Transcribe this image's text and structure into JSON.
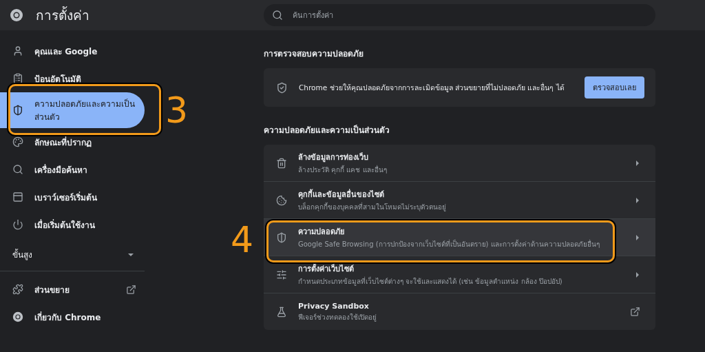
{
  "header": {
    "title": "การตั้งค่า"
  },
  "search": {
    "placeholder": "ค้นการตั้งค่า"
  },
  "sidebar": {
    "items": [
      {
        "label": "คุณและ Google",
        "selected": false
      },
      {
        "label": "ป้อนอัตโนมัติ",
        "selected": false
      },
      {
        "label": "ความปลอดภัยและความเป็นส่วนตัว",
        "selected": true
      },
      {
        "label": "ลักษณะที่ปรากฏ",
        "selected": false
      },
      {
        "label": "เครื่องมือค้นหา",
        "selected": false
      },
      {
        "label": "เบราว์เซอร์เริ่มต้น",
        "selected": false
      },
      {
        "label": "เมื่อเริ่มต้นใช้งาน",
        "selected": false
      }
    ],
    "advanced": {
      "label": "ขั้นสูง",
      "expanded": false
    },
    "bottom_items": [
      {
        "label": "ส่วนขยาย"
      },
      {
        "label": "เกี่ยวกับ Chrome"
      }
    ]
  },
  "safety_check": {
    "heading": "การตรวจสอบความปลอดภัย",
    "text": "Chrome ช่วยให้คุณปลอดภัยจากการละเมิดข้อมูล ส่วนขยายที่ไม่ปลอดภัย และอื่นๆ ได้",
    "button": "ตรวจสอบเลย"
  },
  "privacy": {
    "heading": "ความปลอดภัยและความเป็นส่วนตัว",
    "rows": [
      {
        "title": "ล้างข้อมูลการท่องเว็บ",
        "subtitle": "ล้างประวัติ คุกกี้ แคช และอื่นๆ",
        "kind": "arrow",
        "selected": false
      },
      {
        "title": "คุกกี้และข้อมูลอื่นของไซต์",
        "subtitle": "บล็อกคุกกี้ของบุคคลที่สามในโหมดไม่ระบุตัวตนอยู่",
        "kind": "arrow",
        "selected": false
      },
      {
        "title": "ความปลอดภัย",
        "subtitle": "Google Safe Browsing (การปกป้องจากเว็บไซต์ที่เป็นอันตราย) และการตั้งค่าด้านความปลอดภัยอื่นๆ",
        "kind": "arrow",
        "selected": true
      },
      {
        "title": "การตั้งค่าเว็บไซต์",
        "subtitle": "กำหนดประเภทข้อมูลที่เว็บไซต์ต่างๆ จะใช้และแสดงได้ (เช่น ข้อมูลตำแหน่ง กล้อง ป๊อปอัป)",
        "kind": "arrow",
        "selected": false
      },
      {
        "title": "Privacy Sandbox",
        "subtitle": "ฟีเจอร์ช่วงทดลองใช้เปิดอยู่",
        "kind": "external",
        "selected": false
      }
    ]
  },
  "annotations": [
    {
      "label": "3"
    },
    {
      "label": "4"
    }
  ]
}
